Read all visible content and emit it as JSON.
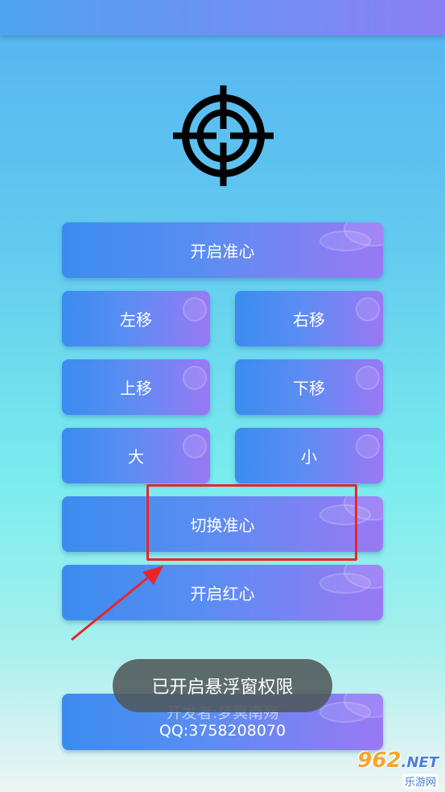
{
  "buttons": {
    "open_crosshair": "开启准心",
    "move_left": "左移",
    "move_right": "右移",
    "move_up": "上移",
    "move_down": "下移",
    "bigger": "大",
    "smaller": "小",
    "switch_crosshair": "切换准心",
    "open_red_dot": "开启红心"
  },
  "developer": {
    "line1": "开发者:梦冥南殇",
    "line2": "QQ:3758208070"
  },
  "toast": "已开启悬浮窗权限",
  "watermark": {
    "logo": "962",
    "domain": ".NET",
    "subtitle": "乐游网"
  },
  "colors": {
    "accent_left": "#3b8cef",
    "accent_right": "#9a78f5",
    "highlight": "#e8262a",
    "toast_bg": "#4e585a"
  },
  "icons": [
    "crosshair-icon",
    "annotation-arrow"
  ]
}
